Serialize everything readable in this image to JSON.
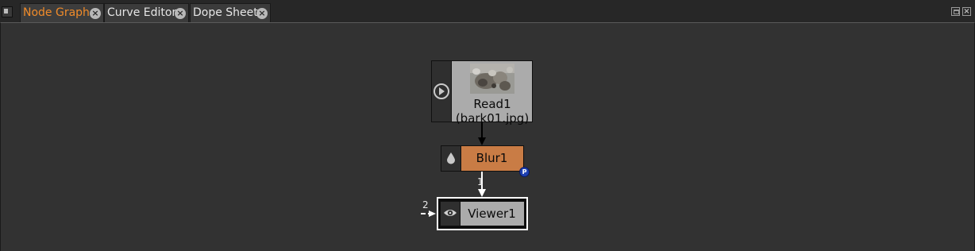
{
  "tabs": [
    {
      "label": "Node Graph",
      "active": true
    },
    {
      "label": "Curve Editor",
      "active": false
    },
    {
      "label": "Dope Sheet",
      "active": false
    }
  ],
  "icons": {
    "tab_close": "circle-x-icon",
    "pane_menu": "pane-menu-icon",
    "float_window": "float-window-icon",
    "close_window": "close-window-icon"
  },
  "colors": {
    "active_tab": "#f08b2a",
    "blur_node": "#c97c45",
    "read_node": "#ababab",
    "viewer_node": "#ababab",
    "viewer_selection": "#ffffff",
    "background": "#323232"
  },
  "nodes": {
    "read": {
      "name": "Read1",
      "file": "(bark01.jpg)",
      "icon": "play-icon"
    },
    "blur": {
      "name": "Blur1",
      "icon": "drop-icon",
      "badge": "P"
    },
    "viewer": {
      "name": "Viewer1",
      "icon": "eye-icon",
      "input1_label": "1",
      "input2_label": "2"
    }
  }
}
